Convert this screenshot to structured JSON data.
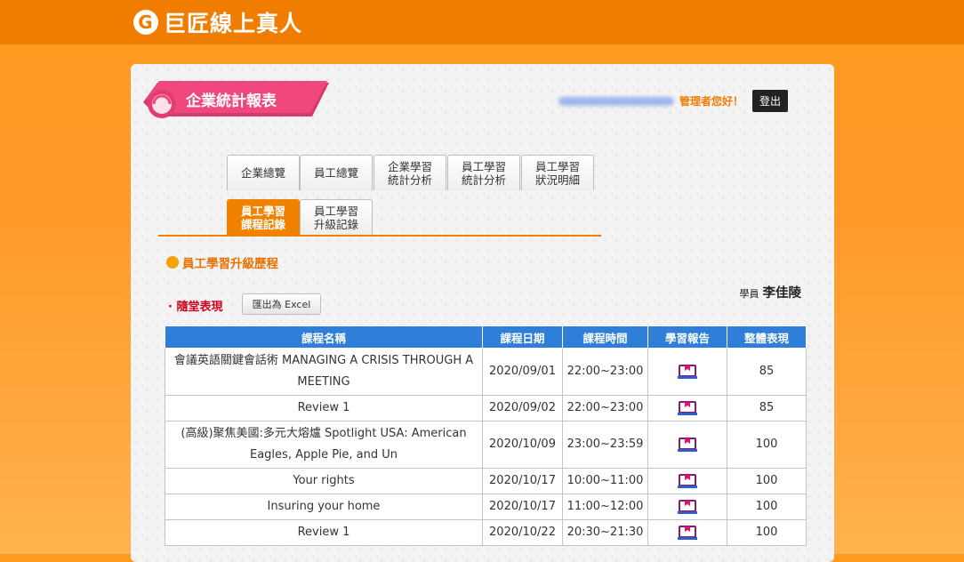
{
  "header": {
    "logo_mark": "G",
    "brand": "巨匠線上真人"
  },
  "page_title": "企業統計報表",
  "admin": {
    "greeting": "管理者您好！",
    "logout_label": "登出"
  },
  "tabs": [
    {
      "label": "企業總覽",
      "active": false
    },
    {
      "label": "員工總覽",
      "active": false
    },
    {
      "label": "企業學習\n統計分析",
      "active": false
    },
    {
      "label": "員工學習\n統計分析",
      "active": false
    },
    {
      "label": "員工學習\n狀況明細",
      "active": false
    },
    {
      "label": "員工學習\n課程記錄",
      "active": true
    },
    {
      "label": "員工學習\n升級記錄",
      "active": false
    }
  ],
  "section_title": "員工學習升級歷程",
  "student": {
    "label": "學員",
    "name": "李佳陵"
  },
  "performance_label": "· 隨堂表現",
  "export_button": "匯出為 Excel",
  "table": {
    "headers": [
      "課程名稱",
      "課程日期",
      "課程時間",
      "學習報告",
      "整體表現"
    ],
    "rows": [
      {
        "name": "會議英語關鍵會話術 MANAGING A CRISIS THROUGH A MEETING",
        "date": "2020/09/01",
        "time": "22:00~23:00",
        "score": "85"
      },
      {
        "name": "Review 1",
        "date": "2020/09/02",
        "time": "22:00~23:00",
        "score": "85"
      },
      {
        "name": "(高級)聚焦美國:多元大熔爐 Spotlight USA: American Eagles, Apple Pie, and Un",
        "date": "2020/10/09",
        "time": "23:00~23:59",
        "score": "100"
      },
      {
        "name": "Your rights",
        "date": "2020/10/17",
        "time": "10:00~11:00",
        "score": "100"
      },
      {
        "name": "Insuring your home",
        "date": "2020/10/17",
        "time": "11:00~12:00",
        "score": "100"
      },
      {
        "name": "Review 1",
        "date": "2020/10/22",
        "time": "20:30~21:30",
        "score": "100"
      }
    ]
  },
  "colors": {
    "orange": "#f07d00",
    "table_header": "#2f7fd8",
    "ribbon": "#f0487d",
    "report_icon": "#8a1a6b"
  }
}
